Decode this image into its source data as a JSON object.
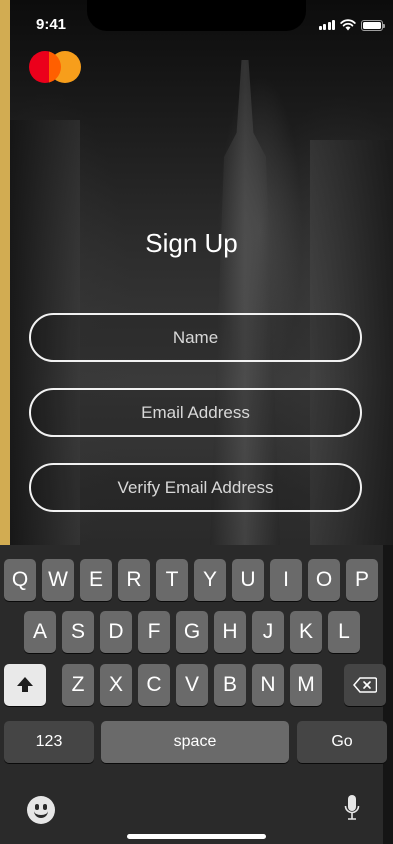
{
  "status_bar": {
    "time": "9:41"
  },
  "brand": {
    "name": "mastercard-logo",
    "colors": {
      "red": "#eb001b",
      "orange": "#f79e1b"
    }
  },
  "page": {
    "title": "Sign Up"
  },
  "form": {
    "name_placeholder": "Name",
    "email_placeholder": "Email Address",
    "verify_email_placeholder": "Verify Email Address"
  },
  "keyboard": {
    "row1": [
      "Q",
      "W",
      "E",
      "R",
      "T",
      "Y",
      "U",
      "I",
      "O",
      "P"
    ],
    "row2": [
      "A",
      "S",
      "D",
      "F",
      "G",
      "H",
      "J",
      "K",
      "L"
    ],
    "row3": [
      "Z",
      "X",
      "C",
      "V",
      "B",
      "N",
      "M"
    ],
    "numbers_label": "123",
    "space_label": "space",
    "go_label": "Go"
  },
  "icons": [
    "signal-icon",
    "wifi-icon",
    "battery-icon",
    "shift-icon",
    "backspace-icon",
    "emoji-icon",
    "microphone-icon"
  ]
}
